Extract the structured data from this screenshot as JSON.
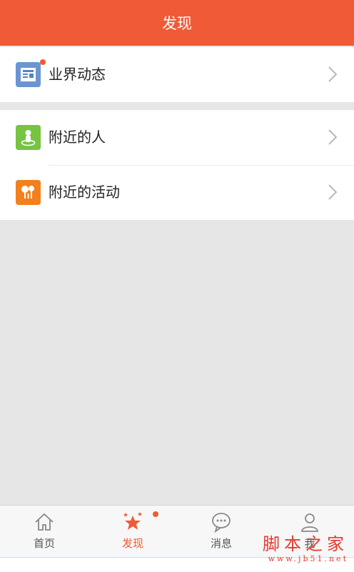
{
  "header": {
    "title": "发现"
  },
  "colors": {
    "accent": "#f15a36",
    "green": "#6bc23a",
    "orange": "#f27a1a",
    "blue": "#4f86c6"
  },
  "sections": [
    {
      "items": [
        {
          "label": "业界动态",
          "icon": "news-icon",
          "badge": true
        }
      ]
    },
    {
      "items": [
        {
          "label": "附近的人",
          "icon": "nearby-people-icon",
          "badge": false
        },
        {
          "label": "附近的活动",
          "icon": "nearby-activity-icon",
          "badge": false
        }
      ]
    }
  ],
  "tabs": [
    {
      "label": "首页",
      "icon": "home-icon",
      "active": false
    },
    {
      "label": "发现",
      "icon": "star-icon",
      "active": true
    },
    {
      "label": "消息",
      "icon": "chat-icon",
      "active": false
    },
    {
      "label": "我",
      "icon": "user-icon",
      "active": false
    }
  ],
  "watermark": {
    "text": "脚本之家",
    "url": "www.jb51.net"
  }
}
